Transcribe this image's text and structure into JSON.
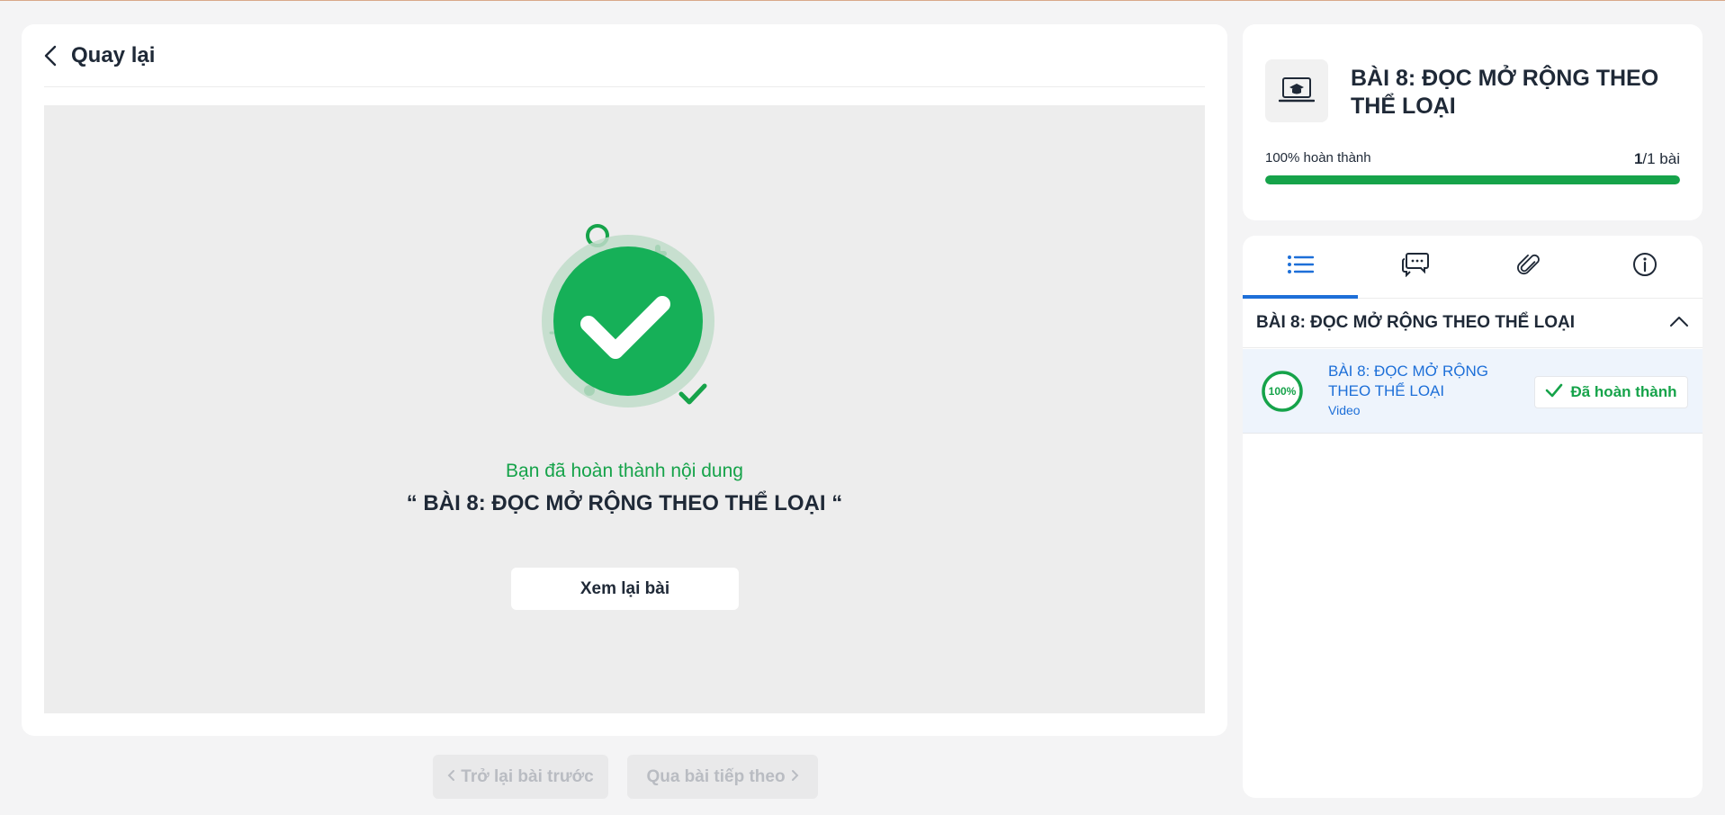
{
  "header": {
    "back_label": "Quay lại"
  },
  "completion": {
    "message": "Bạn đã hoàn thành nội dung",
    "lesson_title": "“ BÀI 8: ĐỌC MỞ RỘNG THEO THỂ LOẠI “",
    "review_button": "Xem lại bài"
  },
  "nav": {
    "prev_label": "Trở lại bài trước",
    "next_label": "Qua bài tiếp theo",
    "prev_icon": "chevron-left-icon",
    "next_icon": "chevron-right-icon"
  },
  "course": {
    "title": "BÀI 8: ĐỌC MỞ RỘNG THEO THỂ LOẠI",
    "icon": "laptop-graduation-cap-icon",
    "progress_label": "100% hoàn thành",
    "progress_percent": 100,
    "count_done": "1",
    "count_total": "/1 bài"
  },
  "tabs": [
    {
      "name": "list-icon",
      "active": true
    },
    {
      "name": "comments-icon",
      "active": false
    },
    {
      "name": "paperclip-icon",
      "active": false
    },
    {
      "name": "info-icon",
      "active": false
    }
  ],
  "section": {
    "title": "BÀI 8: ĐỌC MỞ RỘNG THEO THỂ LOẠI",
    "toggle_icon": "chevron-up-icon",
    "lessons": [
      {
        "progress": "100%",
        "title": "BÀI 8: ĐỌC MỞ RỘNG THEO THỂ LOẠI",
        "type": "Video",
        "status": "Đã hoàn thành"
      }
    ]
  },
  "colors": {
    "accent_green": "#16a34a",
    "accent_blue": "#1d6fd8",
    "stage_bg": "#ededed"
  }
}
